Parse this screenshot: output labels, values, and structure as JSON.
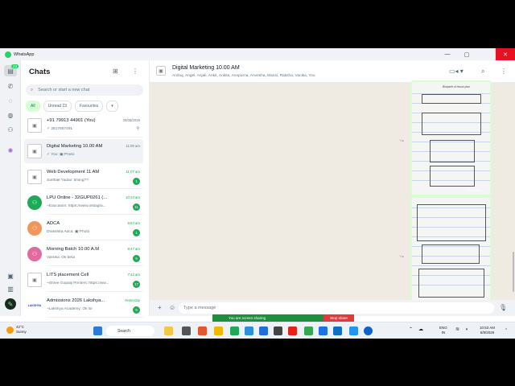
{
  "window": {
    "title": "WhatsApp",
    "min": "—",
    "max": "▢",
    "close": "✕"
  },
  "rail": {
    "chats_badge": "23"
  },
  "sidebar": {
    "title": "Chats",
    "search_placeholder": "Search or start a new chat",
    "filters": [
      {
        "label": "All",
        "active": true
      },
      {
        "label": "Unread 23",
        "active": false
      },
      {
        "label": "Favourites",
        "active": false
      },
      {
        "label": "▾",
        "active": false
      }
    ],
    "chats": [
      {
        "name": "+91 79913 44901 (You)",
        "preview": "✓ 2817857491",
        "time": "20/05/2026",
        "badge": "",
        "pinned": true,
        "avatar": "doc",
        "selected": false,
        "green": false
      },
      {
        "name": "Digital Marketing 10.00 AM",
        "preview": "✓ You: ▣ Photo",
        "time": "11:09 am",
        "badge": "",
        "pinned": false,
        "avatar": "doc",
        "selected": true,
        "green": false
      },
      {
        "name": "Web Development 11 AM",
        "preview": "Sarthak Yadav: timing??",
        "time": "11:07 am",
        "badge": "1",
        "pinned": false,
        "avatar": "doc",
        "selected": false,
        "green": true
      },
      {
        "name": "LPU Online - 32GUP0261 (...",
        "preview": "~Education: https://www.instagra...",
        "time": "10:10 am",
        "badge": "11",
        "pinned": false,
        "avatar": "green",
        "selected": false,
        "green": true
      },
      {
        "name": "ADCA",
        "preview": "Drakshita Adca: ▣ Photo",
        "time": "9:53 am",
        "badge": "1",
        "pinned": false,
        "avatar": "orange",
        "selected": false,
        "green": true
      },
      {
        "name": "Morning Batch 10.00 A.M",
        "preview": "Varsika: Ok beta",
        "time": "8:47 am",
        "badge": "9",
        "pinned": false,
        "avatar": "pink",
        "selected": false,
        "green": true
      },
      {
        "name": "LITS placement Cell",
        "preview": "~Shree Gopalji Printers: https://ww...",
        "time": "7:42 am",
        "badge": "17",
        "pinned": false,
        "avatar": "doc",
        "selected": false,
        "green": true
      },
      {
        "name": "Admissions 2026 Lakshya...",
        "preview": "~Lakshya Academy: Ok sir",
        "time": "Yesterday",
        "badge": "9",
        "pinned": false,
        "avatar": "logo",
        "selected": false,
        "green": true
      }
    ],
    "logo_text": "LAKSHYA"
  },
  "conversation": {
    "name": "Digital Marketing 10.00 AM",
    "members": "Ambuj, Angel, Anjali, Ankit, Ankita, Annpurna, Anvesha, Mansi, Raksha, Vanika, You",
    "images": [
      {
        "caption": "Blueprint of house plan",
        "time": "11:08 am ✓✓"
      },
      {
        "caption": "",
        "time": ""
      }
    ],
    "composer_placeholder": "Type a message"
  },
  "screen_share": {
    "status": "You are screen sharing",
    "stop": "Stop share"
  },
  "taskbar": {
    "temp": "42°C",
    "weather": "Sunny",
    "search": "Search",
    "lang1": "ENG",
    "lang2": "IN",
    "time": "10:53 AM",
    "date": "6/9/2026"
  },
  "colors": {
    "accent": "#25d366",
    "badge": "#1fa855",
    "share_green": "#1e8f3d",
    "share_red": "#e03a3a"
  }
}
